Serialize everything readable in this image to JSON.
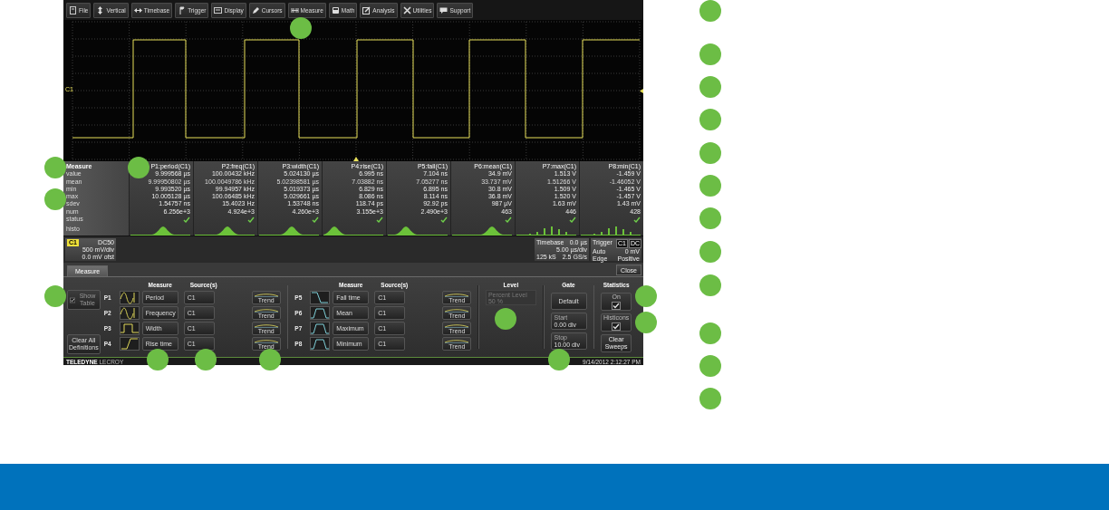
{
  "menu": [
    {
      "label": "File"
    },
    {
      "label": "Vertical"
    },
    {
      "label": "Timebase"
    },
    {
      "label": "Trigger"
    },
    {
      "label": "Display"
    },
    {
      "label": "Cursors"
    },
    {
      "label": "Measure"
    },
    {
      "label": "Math"
    },
    {
      "label": "Analysis"
    },
    {
      "label": "Utilities"
    },
    {
      "label": "Support"
    }
  ],
  "trace": {
    "label": "C1"
  },
  "measure_table": {
    "row_labels": [
      "Measure",
      "value",
      "mean",
      "min",
      "max",
      "sdev",
      "num",
      "status",
      "histo"
    ],
    "columns": [
      {
        "header": "P1:period(C1)",
        "values": [
          "9.999568 µs",
          "9.99950802 µs",
          "9.993520 µs",
          "10.005128 µs",
          "1.54757 ns",
          "6.256e+3"
        ],
        "status": true,
        "histogram": {
          "kind": "hump"
        }
      },
      {
        "header": "P2:freq(C1)",
        "values": [
          "100.00432 kHz",
          "100.0049786 kHz",
          "99.94957 kHz",
          "100.06485 kHz",
          "15.4023 Hz",
          "4.924e+3"
        ],
        "status": true,
        "histogram": {
          "kind": "hump"
        }
      },
      {
        "header": "P3:width(C1)",
        "values": [
          "5.024130 µs",
          "5.02398581 µs",
          "5.019373 µs",
          "5.029661 µs",
          "1.53748 ns",
          "4.260e+3"
        ],
        "status": true,
        "histogram": {
          "kind": "hump"
        }
      },
      {
        "header": "P4:rise(C1)",
        "values": [
          "6.995 ns",
          "7.03882 ns",
          "6.829 ns",
          "8.086 ns",
          "118.74 ps",
          "3.155e+3"
        ],
        "status": true,
        "histogram": {
          "kind": "hump"
        }
      },
      {
        "header": "P5:fall(C1)",
        "values": [
          "7.104 ns",
          "7.05277 ns",
          "6.895 ns",
          "8.114 ns",
          "92.92 ps",
          "2.490e+3"
        ],
        "status": true,
        "histogram": {
          "kind": "hump"
        }
      },
      {
        "header": "P6:mean(C1)",
        "values": [
          "34.9 mV",
          "33.737 mV",
          "30.8 mV",
          "36.8 mV",
          "987 µV",
          "463"
        ],
        "status": true,
        "histogram": {
          "kind": "hump"
        }
      },
      {
        "header": "P7:max(C1)",
        "values": [
          "1.513 V",
          "1.51266 V",
          "1.509 V",
          "1.520 V",
          "1.63 mV",
          "446"
        ],
        "status": true,
        "histogram": {
          "kind": "bars"
        }
      },
      {
        "header": "P8:min(C1)",
        "values": [
          "-1.459 V",
          "-1.46052 V",
          "-1.465 V",
          "-1.457 V",
          "1.43 mV",
          "428"
        ],
        "status": true,
        "histogram": {
          "kind": "bars"
        }
      }
    ]
  },
  "channel": {
    "badge": "C1",
    "coupling": "DC50",
    "scale": "500 mV/div",
    "offset": "0.0 mV ofst"
  },
  "timebase": {
    "label": "Timebase",
    "delay": "0.0 µs",
    "scale": "5.00 µs/div",
    "samples": "125 kS",
    "rate": "2.5 GS/s"
  },
  "trigger": {
    "label": "Trigger",
    "source": "C1",
    "coupling": "DC",
    "mode": "Auto",
    "level": "0 mV",
    "type": "Edge",
    "slope": "Positive"
  },
  "dialog": {
    "tabs": [
      {
        "label": "Measure",
        "selected": true
      }
    ],
    "close": "Close",
    "show_table": {
      "label": "Show Table",
      "checked": true
    },
    "clear_all": "Clear All Definitions",
    "column_headers": [
      {
        "measure": "Measure",
        "sources": "Source(s)"
      },
      {
        "measure": "Measure",
        "sources": "Source(s)"
      }
    ],
    "params": [
      {
        "id": "P1",
        "measure": "Period",
        "source": "C1",
        "trend": "Trend"
      },
      {
        "id": "P2",
        "measure": "Frequency",
        "source": "C1",
        "trend": "Trend"
      },
      {
        "id": "P3",
        "measure": "Width",
        "source": "C1",
        "trend": "Trend"
      },
      {
        "id": "P4",
        "measure": "Rise time",
        "source": "C1",
        "trend": "Trend"
      },
      {
        "id": "P5",
        "measure": "Fall time",
        "source": "C1",
        "trend": "Trend"
      },
      {
        "id": "P6",
        "measure": "Mean",
        "source": "C1",
        "trend": "Trend"
      },
      {
        "id": "P7",
        "measure": "Maximum",
        "source": "C1",
        "trend": "Trend"
      },
      {
        "id": "P8",
        "measure": "Minimum",
        "source": "C1",
        "trend": "Trend"
      }
    ],
    "level": {
      "header": "Level",
      "label": "Percent Level",
      "value": "50 %",
      "disabled": true
    },
    "gate": {
      "header": "Gate",
      "default": "Default",
      "start": {
        "label": "Start",
        "value": "0.00 div"
      },
      "stop": {
        "label": "Stop",
        "value": "10.00 div"
      }
    },
    "statistics": {
      "header": "Statistics",
      "on": {
        "label": "On",
        "checked": true
      },
      "histicons": {
        "label": "Histicons",
        "checked": true
      },
      "clear": "Clear Sweeps"
    }
  },
  "footer": {
    "brand": "TELEDYNE",
    "brand_suffix": "LECROY",
    "datetime": "9/14/2012 2:12:27 PM"
  }
}
